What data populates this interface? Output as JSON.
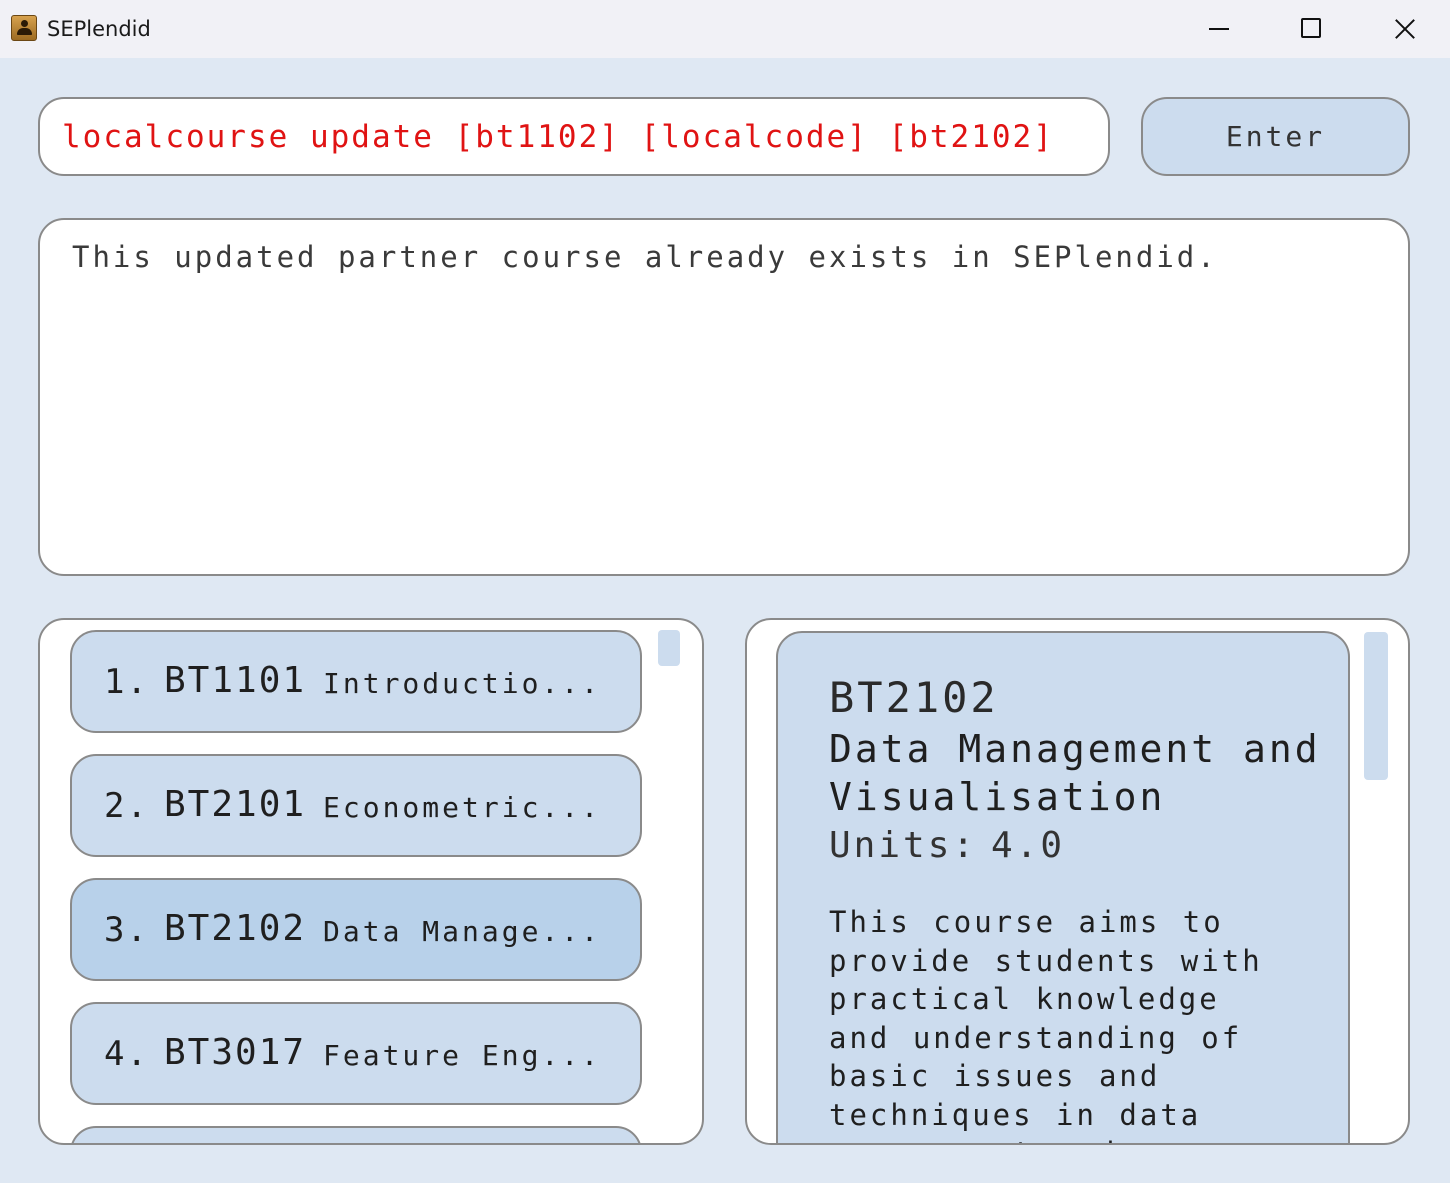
{
  "window": {
    "title": "SEPlendid",
    "icon": "address-book-icon"
  },
  "command": {
    "value": "localcourse update [bt1102] [localcode] [bt2102]",
    "text_color": "#e01313"
  },
  "enter_button": {
    "label": "Enter"
  },
  "result": {
    "message": "This updated partner course already exists in SEPlendid."
  },
  "course_list": {
    "items": [
      {
        "index": "1.",
        "code": "BT1101",
        "name": "Introductio..."
      },
      {
        "index": "2.",
        "code": "BT2101",
        "name": "Econometric..."
      },
      {
        "index": "3.",
        "code": "BT2102",
        "name": "Data Manage...",
        "selected": true
      },
      {
        "index": "4.",
        "code": "BT3017",
        "name": "Feature Eng..."
      }
    ]
  },
  "course_detail": {
    "code": "BT2102",
    "title": "Data Management and Visualisation",
    "units_label": "Units:",
    "units_value": "4.0",
    "description": "This course aims to provide students with practical knowledge and understanding of basic issues and techniques in data management and warehousing with"
  },
  "colors": {
    "background": "#dfe8f3",
    "card": "#ccdcee",
    "selected_card": "#b8d1ea",
    "border": "#8a8a8a"
  }
}
